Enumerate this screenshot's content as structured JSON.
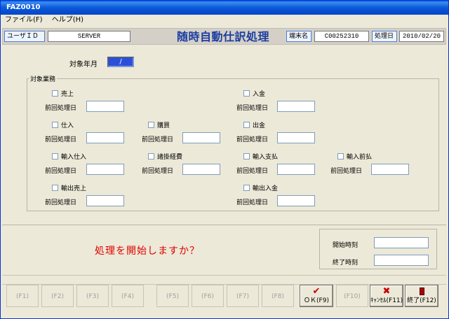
{
  "window": {
    "title": "FAZ0010"
  },
  "menu": [
    {
      "label": "ファイル(F)"
    },
    {
      "label": "ヘルプ(H)"
    }
  ],
  "header": {
    "user_id_label": "ユーザＩＤ",
    "user_id_value": "SERVER",
    "page_title": "随時自動仕訳処理",
    "terminal_label": "端末名",
    "terminal_value": "C00252310",
    "process_date_label": "処理日",
    "process_date_value": "2010/02/20"
  },
  "target_month": {
    "label": "対象年月",
    "value": "/"
  },
  "work_group": {
    "title": "対象業務",
    "prev_date_label": "前回処理日",
    "items": [
      {
        "label": "売上"
      },
      {
        "label": "入金"
      },
      {
        "label": "仕入"
      },
      {
        "label": "購買"
      },
      {
        "label": "出金"
      },
      {
        "label": "輸入仕入"
      },
      {
        "label": "諸掛経費"
      },
      {
        "label": "輸入支払"
      },
      {
        "label": "輸入前払"
      },
      {
        "label": "輸出売上"
      },
      {
        "label": "輸出入金"
      }
    ]
  },
  "confirm_message": "処理を開始しますか？",
  "times": {
    "start_label": "開始時刻",
    "end_label": "終了時刻"
  },
  "function_keys": [
    {
      "label": "(F1)"
    },
    {
      "label": "(F2)"
    },
    {
      "label": "(F3)"
    },
    {
      "label": "(F4)"
    },
    {
      "label": "(F5)"
    },
    {
      "label": "(F6)"
    },
    {
      "label": "(F7)"
    },
    {
      "label": "(F8)"
    },
    {
      "label": "ＯＫ(F9)",
      "icon": "checkmark-icon"
    },
    {
      "label": "(F10)"
    },
    {
      "label": "ｷｬﾝｾﾙ(F11)",
      "icon": "cancel-x-icon"
    },
    {
      "label": "終了(F12)",
      "icon": "exit-door-icon"
    }
  ],
  "colors": {
    "title_bar": "#0b58d8",
    "message": "#e00000",
    "page_title": "#1a3da0",
    "month_field": "#2b4fd8"
  }
}
